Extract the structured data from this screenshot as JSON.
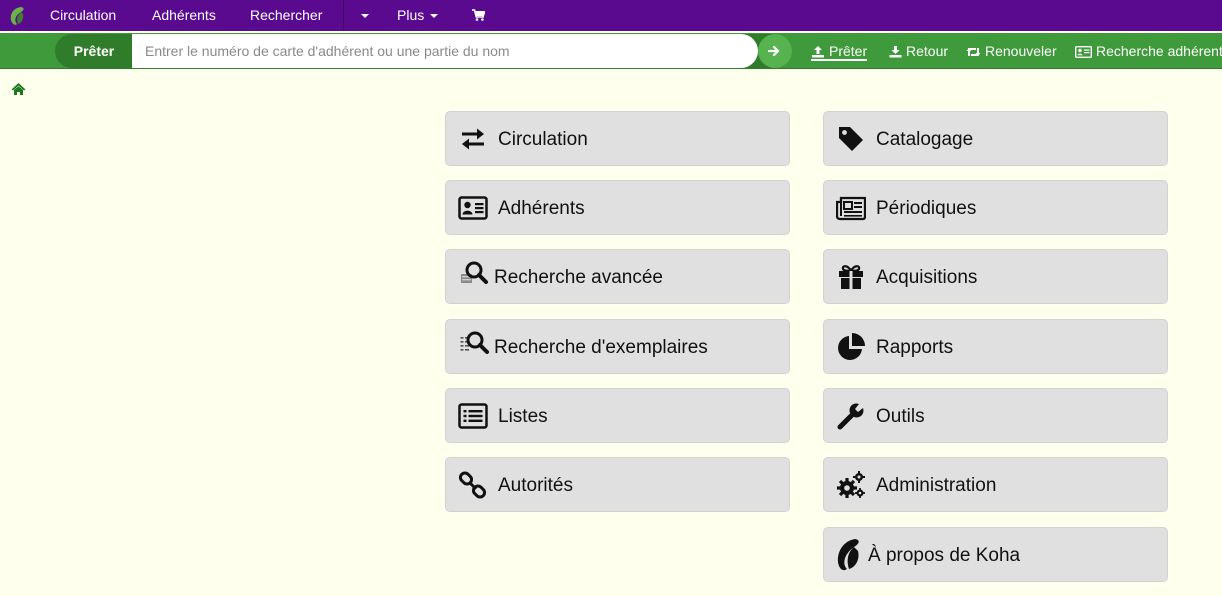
{
  "topnav": {
    "items": [
      {
        "label": "Circulation"
      },
      {
        "label": "Adhérents"
      },
      {
        "label": "Rechercher"
      },
      {
        "label": "Plus"
      }
    ],
    "cart_icon": "shopping-cart-icon"
  },
  "circ_bar": {
    "mode_label": "Prêter",
    "search_placeholder": "Entrer le numéro de carte d'adhérent ou une partie du nom",
    "search_value": "",
    "tabs": [
      {
        "label": "Prêter",
        "icon": "upload-icon",
        "active": true
      },
      {
        "label": "Retour",
        "icon": "download-icon"
      },
      {
        "label": "Renouveler",
        "icon": "retweet-icon"
      },
      {
        "label": "Recherche adhérent",
        "icon": "id-card-icon"
      }
    ]
  },
  "modules": {
    "left": [
      {
        "label": "Circulation",
        "icon": "exchange-arrows-icon"
      },
      {
        "label": "Adhérents",
        "icon": "id-card-icon"
      },
      {
        "label": "Recherche avancée",
        "icon": "advanced-search-icon"
      },
      {
        "label": "Recherche d'exemplaires",
        "icon": "item-search-icon"
      },
      {
        "label": "Listes",
        "icon": "list-icon"
      },
      {
        "label": "Autorités",
        "icon": "link-icon"
      }
    ],
    "right": [
      {
        "label": "Catalogage",
        "icon": "tag-icon"
      },
      {
        "label": "Périodiques",
        "icon": "newspaper-icon"
      },
      {
        "label": "Acquisitions",
        "icon": "gift-icon"
      },
      {
        "label": "Rapports",
        "icon": "pie-chart-icon"
      },
      {
        "label": "Outils",
        "icon": "wrench-icon"
      },
      {
        "label": "Administration",
        "icon": "gears-icon"
      },
      {
        "label": "À propos de Koha",
        "icon": "koha-logo-icon"
      }
    ]
  },
  "colors": {
    "topnav_bg": "#5a0a8e",
    "circbar_bg": "#3e9a3a",
    "page_bg": "#ffffee",
    "tile_bg": "#e0e0e0"
  }
}
